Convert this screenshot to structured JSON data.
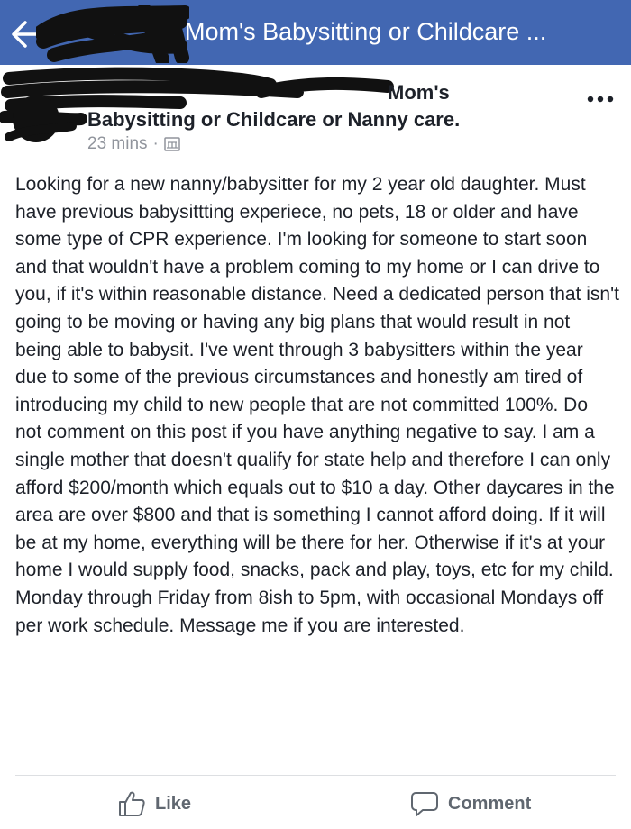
{
  "header": {
    "title": "Mom's Babysitting or Childcare ...",
    "back_icon": "back-arrow-icon"
  },
  "post": {
    "group_name_line1": "Mom's",
    "group_name_line2": "Babysitting or Childcare or Nanny care.",
    "time": "23 mins",
    "separator": "·",
    "privacy_icon": "group-members-icon",
    "more_icon": "more-options-icon",
    "body": "Looking for a new nanny/babysitter for my 2 year old daughter. Must have previous babysittting experiece, no pets, 18 or older and have some type of CPR experience. I'm looking for someone to start soon and that wouldn't have a problem coming to my home or I can drive to you, if it's within reasonable distance. Need a dedicated person that isn't going to be moving or having any big plans that would result in not being able to babysit. I've went through 3 babysitters within the year due to some of the previous circumstances and honestly am tired of introducing my child to new people that are not committed 100%. Do not comment on this post if you have anything negative to say. I am a single mother that doesn't qualify for state help and therefore I can only afford $200/month which equals out to $10 a day. Other daycares in the area are over $800 and that is something I cannot afford doing. If it will be at my home, everything will be there for her. Otherwise if it's at your home I would supply food, snacks, pack and play, toys, etc for my child. Monday through Friday from 8ish to 5pm, with occasional Mondays off per work schedule. Message me if you are interested."
  },
  "actions": {
    "like_label": "Like",
    "comment_label": "Comment"
  },
  "colors": {
    "brand_blue": "#4267b2",
    "text": "#1d2129",
    "meta": "#90949c",
    "action": "#606770"
  }
}
